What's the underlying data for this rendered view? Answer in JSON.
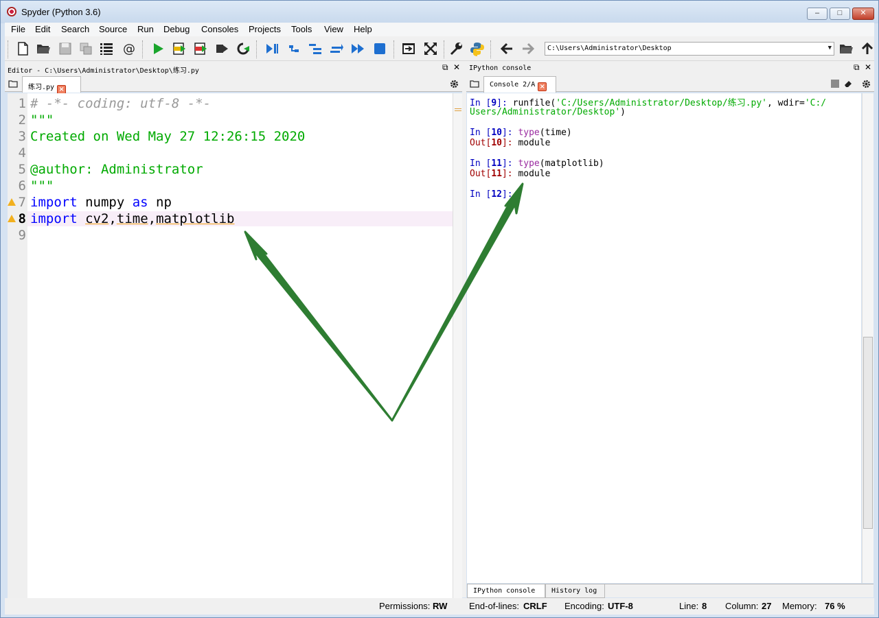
{
  "window": {
    "title": "Spyder (Python 3.6)"
  },
  "menu": [
    "File",
    "Edit",
    "Search",
    "Source",
    "Run",
    "Debug",
    "Consoles",
    "Projects",
    "Tools",
    "View",
    "Help"
  ],
  "toolbar": {
    "working_dir": "C:\\Users\\Administrator\\Desktop"
  },
  "editor": {
    "pane_title": "Editor - C:\\Users\\Administrator\\Desktop\\练习.py",
    "tab_label": "练习.py",
    "lines": [
      {
        "n": "1",
        "text": "# -*- coding: utf-8 -*-"
      },
      {
        "n": "2",
        "text": "\"\"\""
      },
      {
        "n": "3",
        "text": "Created on Wed May 27 12:26:15 2020"
      },
      {
        "n": "4",
        "text": ""
      },
      {
        "n": "5",
        "text": "@author: Administrator"
      },
      {
        "n": "6",
        "text": "\"\"\""
      },
      {
        "n": "7",
        "kw1": "import",
        "mod": " numpy ",
        "kw2": "as",
        "alias": " np"
      },
      {
        "n": "8",
        "kw1": "import",
        "mods": [
          "cv2",
          "time",
          "matplotlib"
        ]
      },
      {
        "n": "9",
        "text": ""
      }
    ],
    "current_line": "8"
  },
  "console": {
    "pane_title": "IPython console",
    "tab_label": "Console 2/A",
    "entries": {
      "in9_prefix": "In [",
      "in9_num": "9",
      "in9_suffix": "]: ",
      "in9_code1": "runfile(",
      "in9_str1": "'C:/Users/Administrator/Desktop/练习.py'",
      "in9_code2": ", wdir=",
      "in9_str2a": "'C:/",
      "in9_str2b": "Users/Administrator/Desktop'",
      "in9_code3": ")",
      "in10_num": "10",
      "in10_fn": "type",
      "in10_arg": "(time)",
      "out10_num": "10",
      "out10_val": "module",
      "in11_num": "11",
      "in11_fn": "type",
      "in11_arg": "(matplotlib)",
      "out11_num": "11",
      "out11_val": "module",
      "in12_num": "12"
    },
    "prompts": {
      "in": "In [",
      "out": "Out[",
      "close": "]: "
    },
    "bottom_tabs": [
      "IPython console",
      "History log"
    ]
  },
  "status": {
    "permissions_label": "Permissions:",
    "permissions": "RW",
    "eol_label": "End-of-lines:",
    "eol": "CRLF",
    "encoding_label": "Encoding:",
    "encoding": "UTF-8",
    "line_label": "Line:",
    "line": "8",
    "column_label": "Column:",
    "column": "27",
    "memory_label": "Memory:",
    "memory": "76 %"
  },
  "colors": {
    "arrow": "#2e7d32",
    "string": "#00aa00",
    "keyword": "#0000ff"
  }
}
